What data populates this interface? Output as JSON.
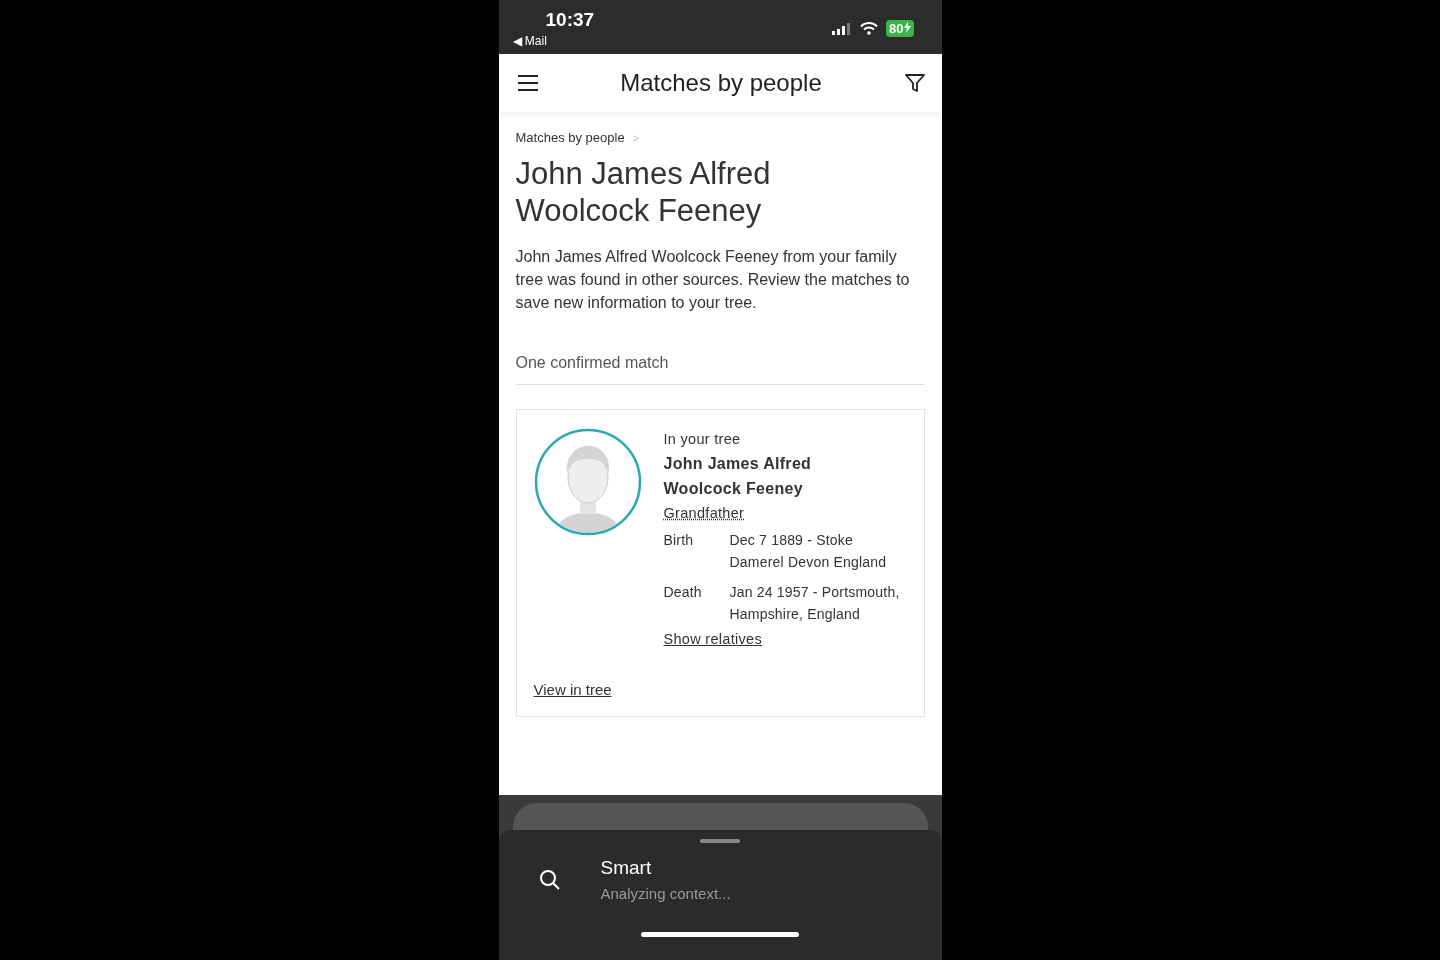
{
  "status_bar": {
    "time": "10:37",
    "back_label": "◀ Mail",
    "battery": "80"
  },
  "header": {
    "title": "Matches by people"
  },
  "breadcrumb": {
    "items": [
      "Matches by people"
    ],
    "separator": ">"
  },
  "person": {
    "name": "John James Alfred Woolcock Feeney",
    "description": "John James Alfred Woolcock Feeney from your family tree was found in other sources. Review the matches to save new information to your tree."
  },
  "section": {
    "title": "One confirmed match"
  },
  "match_card": {
    "source": "In your tree",
    "name_lines": [
      "John James Alfred",
      "Woolcock Feeney"
    ],
    "relation": "Grandfather",
    "facts": [
      {
        "label": "Birth",
        "value": "Dec 7 1889 - Stoke Damerel Devon England"
      },
      {
        "label": "Death",
        "value": "Jan 24 1957 - Portsmouth, Hampshire, England"
      }
    ],
    "show_relatives": "Show relatives",
    "view_in_tree": "View in tree"
  },
  "bottom_sheet": {
    "title": "Smart",
    "subtitle": "Analyzing context..."
  }
}
